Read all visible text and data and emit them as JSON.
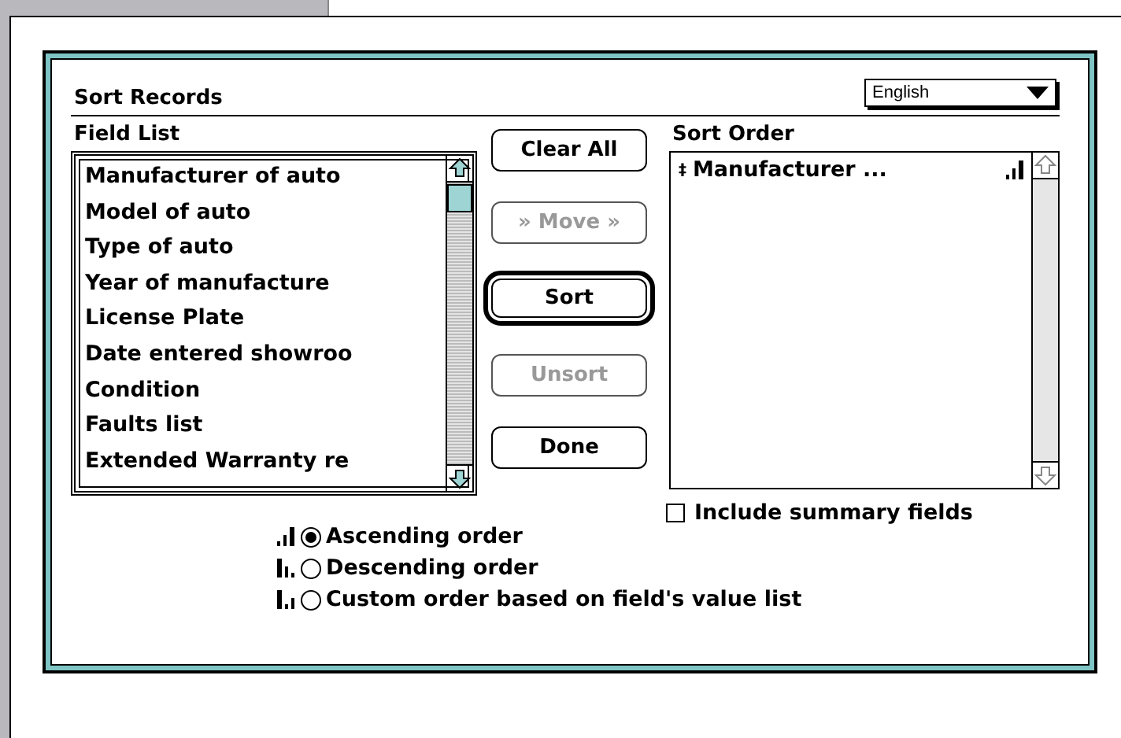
{
  "dialog": {
    "title": "Sort Records",
    "language": {
      "value": "English"
    }
  },
  "field_list": {
    "label": "Field List",
    "items": [
      {
        "label": "Manufacturer of auto",
        "selected": false
      },
      {
        "label": "Model of auto",
        "selected": false
      },
      {
        "label": "Type of auto",
        "selected": false
      },
      {
        "label": "Year of manufacture",
        "selected": false
      },
      {
        "label": "License Plate",
        "selected": false
      },
      {
        "label": "Date entered showroo",
        "selected": false
      },
      {
        "label": "Condition",
        "selected": false
      },
      {
        "label": "Faults list",
        "selected": false
      },
      {
        "label": "Extended Warranty re",
        "selected": false
      }
    ]
  },
  "buttons": [
    {
      "label": "Clear All",
      "disabled": false,
      "default": false
    },
    {
      "label": "» Move »",
      "disabled": true,
      "default": false
    },
    {
      "label": "Sort",
      "disabled": false,
      "default": true
    },
    {
      "label": "Unsort",
      "disabled": true,
      "default": false
    },
    {
      "label": "Done",
      "disabled": false,
      "default": false
    }
  ],
  "sort_order": {
    "label": "Sort Order",
    "items": [
      {
        "marker": "‡",
        "label": "Manufacturer ...",
        "kind": "ascending"
      }
    ]
  },
  "include_summary": {
    "label": "Include summary fields",
    "checked": false
  },
  "order_options": [
    {
      "label": "Ascending order",
      "kind": "ascending",
      "selected": true
    },
    {
      "label": "Descending order",
      "kind": "descending",
      "selected": false
    },
    {
      "label": "Custom order based on field's value list",
      "kind": "custom",
      "selected": false
    }
  ]
}
